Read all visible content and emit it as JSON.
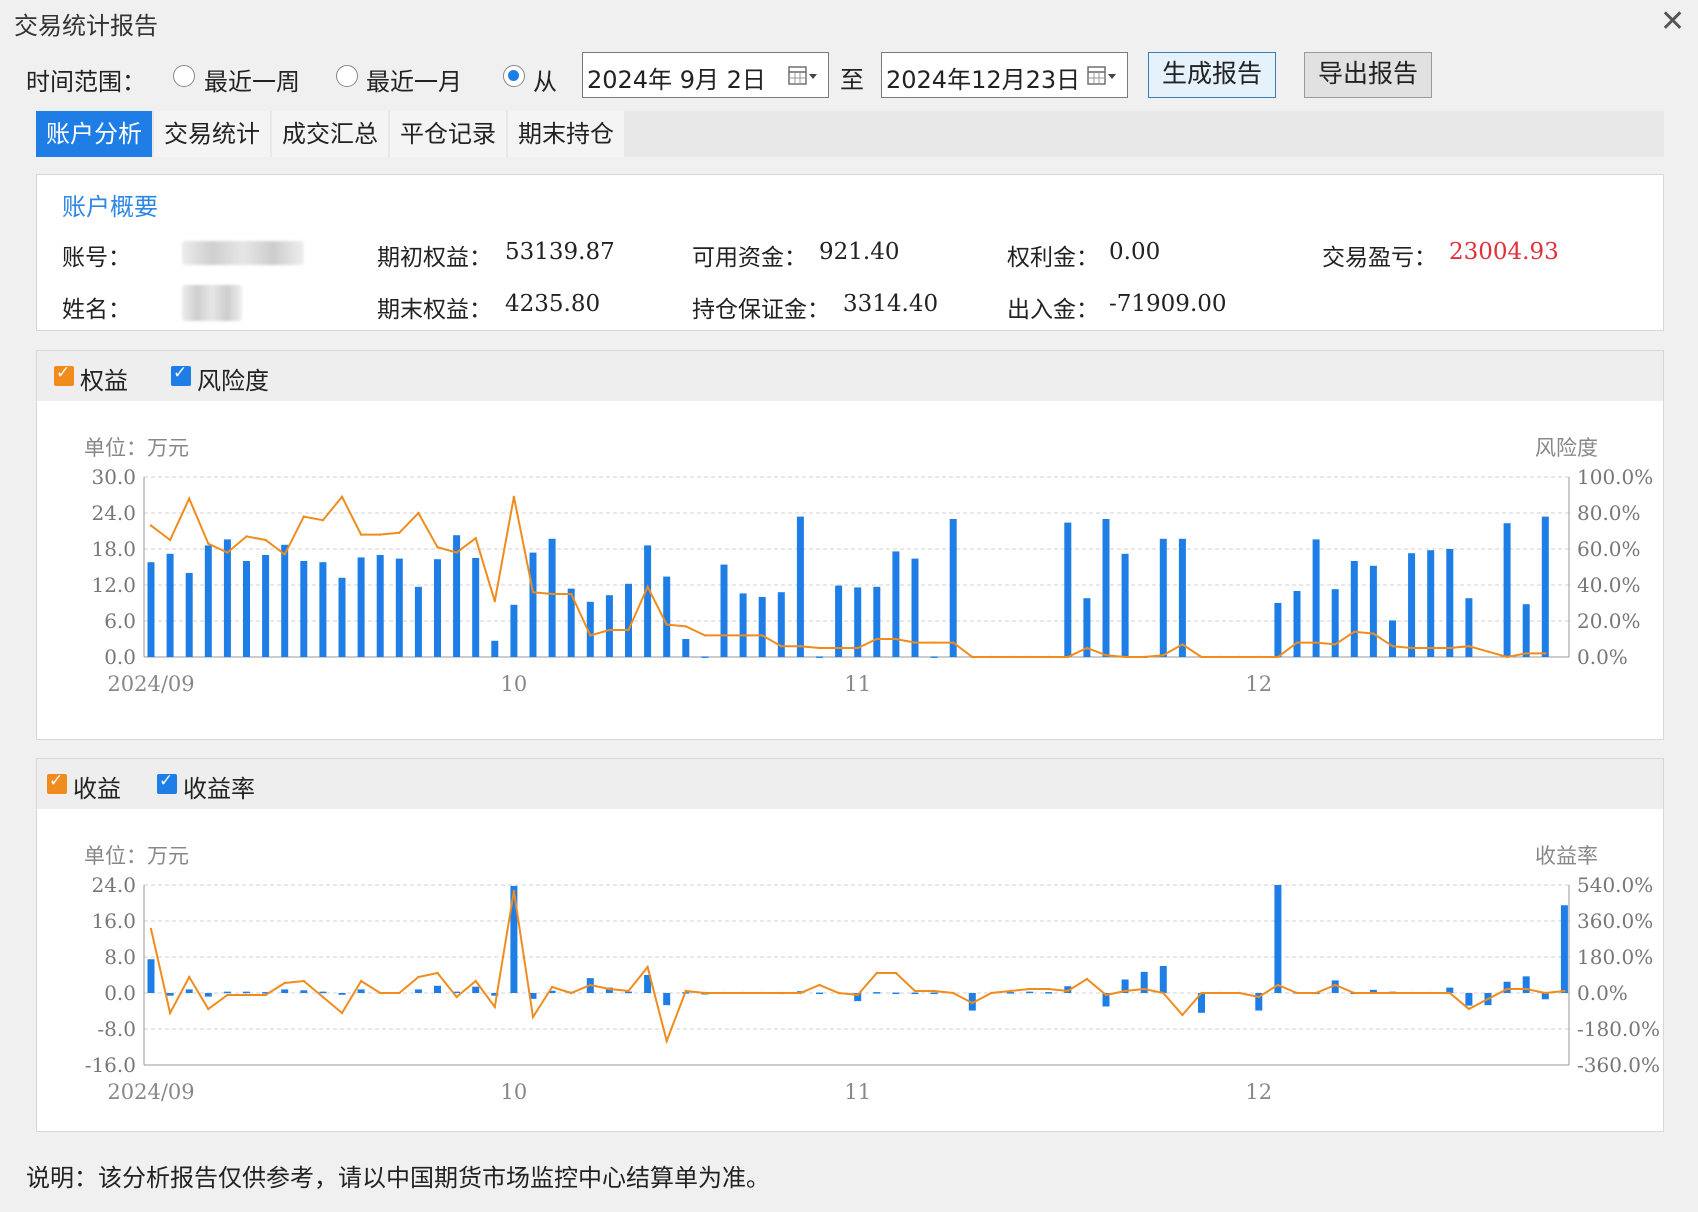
{
  "window": {
    "title": "交易统计报告",
    "close_glyph": "✕"
  },
  "time_range": {
    "label": "时间范围：",
    "options": [
      "最近一周",
      "最近一月",
      "从"
    ],
    "selected_index": 2,
    "from_date": "2024年 9月 2日",
    "to_label": "至",
    "to_date": "2024年12月23日",
    "date_picker_icon": "calendar-dropdown-icon"
  },
  "buttons": {
    "generate": "生成报告",
    "export": "导出报告"
  },
  "tabs": {
    "items": [
      "账户分析",
      "交易统计",
      "成交汇总",
      "平仓记录",
      "期末持仓"
    ],
    "active": 0
  },
  "summary": {
    "title": "账户概要",
    "account_label": "账号：",
    "name_label": "姓名：",
    "initial_equity_label": "期初权益：",
    "initial_equity": "53139.87",
    "final_equity_label": "期末权益：",
    "final_equity": "4235.80",
    "available_label": "可用资金：",
    "available": "921.40",
    "margin_label": "持仓保证金：",
    "margin": "3314.40",
    "premium_label": "权利金：",
    "premium": "0.00",
    "inout_label": "出入金：",
    "inout": "-71909.00",
    "pnl_label": "交易盈亏：",
    "pnl": "23004.93"
  },
  "colors": {
    "accent": "#1e7ee6",
    "line": "#f08c1e",
    "loss": "#e0303a",
    "bar": "#1e7ee6"
  },
  "note": "说明：该分析报告仅供参考，请以中国期货市场监控中心结算单为准。",
  "chart_data": [
    {
      "type": "bar",
      "id": "equity-risk",
      "legend": [
        "权益",
        "风险度"
      ],
      "unit_label": "单位：万元",
      "right_axis_label": "风险度",
      "left_ticks": [
        "30.0",
        "24.0",
        "18.0",
        "12.0",
        "6.0",
        "0.0"
      ],
      "right_ticks": [
        "100.0%",
        "80.0%",
        "60.0%",
        "40.0%",
        "20.0%",
        "0.0%"
      ],
      "x_tick_labels": [
        {
          "label": "2024/09",
          "index": 0
        },
        {
          "label": "10",
          "index": 19
        },
        {
          "label": "11",
          "index": 37
        },
        {
          "label": "12",
          "index": 58
        }
      ],
      "ylim": [
        0,
        30
      ],
      "y2lim": [
        0,
        100
      ],
      "series": [
        {
          "name": "权益",
          "kind": "bar",
          "axis": "left",
          "values": [
            15.8,
            17.2,
            14.0,
            18.6,
            19.6,
            16.0,
            17.0,
            18.7,
            16.0,
            15.8,
            13.2,
            16.6,
            17.0,
            16.4,
            11.7,
            16.3,
            20.3,
            16.5,
            2.7,
            8.7,
            17.4,
            19.7,
            11.4,
            9.2,
            10.3,
            12.2,
            18.6,
            13.4,
            3.0,
            0.1,
            15.4,
            10.6,
            10.0,
            10.8,
            23.4,
            0.1,
            11.9,
            11.6,
            11.7,
            17.6,
            16.4,
            0.1,
            23.0,
            0,
            0,
            0,
            0,
            0,
            22.4,
            9.8,
            23.0,
            17.2,
            0.1,
            19.7,
            19.7,
            0,
            0,
            0,
            0,
            9.0,
            11.0,
            19.6,
            11.3,
            16.0,
            15.2,
            6.1,
            17.3,
            17.8,
            18.0,
            9.8,
            0,
            22.3,
            8.8,
            23.4
          ]
        },
        {
          "name": "风险度",
          "kind": "line",
          "axis": "right",
          "values": [
            73,
            65,
            88,
            63,
            58,
            67,
            65,
            57,
            78,
            76,
            89,
            68,
            68,
            69,
            80,
            61,
            58,
            66,
            31,
            89,
            36,
            35,
            35,
            12,
            15,
            15,
            39,
            18,
            17,
            12,
            12,
            12,
            12,
            6,
            6,
            5,
            5,
            5,
            10,
            10,
            8,
            8,
            8,
            0,
            0,
            0,
            0,
            0,
            0,
            5,
            1,
            0,
            0,
            1,
            7,
            0,
            0,
            0,
            0,
            0,
            8,
            8,
            7,
            14,
            13,
            6,
            5,
            5,
            5,
            6,
            3,
            0,
            2,
            2
          ]
        }
      ]
    },
    {
      "type": "bar",
      "id": "profit-rate",
      "legend": [
        "收益",
        "收益率"
      ],
      "unit_label": "单位：万元",
      "right_axis_label": "收益率",
      "left_ticks": [
        "24.0",
        "16.0",
        "8.0",
        "0.0",
        "-8.0",
        "-16.0"
      ],
      "right_ticks": [
        "540.0%",
        "360.0%",
        "180.0%",
        "0.0%",
        "-180.0%",
        "-360.0%"
      ],
      "x_tick_labels": [
        {
          "label": "2024/09",
          "index": 0
        },
        {
          "label": "10",
          "index": 19
        },
        {
          "label": "11",
          "index": 37
        },
        {
          "label": "12",
          "index": 58
        }
      ],
      "ylim": [
        -16,
        24
      ],
      "y2lim": [
        -360,
        540
      ],
      "series": [
        {
          "name": "收益",
          "kind": "bar",
          "axis": "left",
          "values": [
            7.5,
            -0.6,
            0.8,
            -0.8,
            0.3,
            0.3,
            0.2,
            0.8,
            0.6,
            0.3,
            -0.4,
            0.8,
            0,
            0,
            0.8,
            1.6,
            0.3,
            1.4,
            -0.6,
            23.8,
            -1.3,
            0.5,
            0.3,
            3.3,
            1.2,
            0.3,
            4.0,
            -2.7,
            0.2,
            -0.3,
            0.2,
            0,
            0,
            0.1,
            0.4,
            0.1,
            0,
            -1.8,
            0.2,
            0.1,
            0.1,
            0.1,
            0,
            -3.9,
            0,
            0.2,
            0.3,
            0.2,
            1.5,
            0,
            -3.0,
            3.0,
            4.7,
            6.0,
            0,
            -4.4,
            0,
            0,
            -3.9,
            24.0,
            0.2,
            0.1,
            2.8,
            0.1,
            0.7,
            0.3,
            0.2,
            0.2,
            1.2,
            -2.8,
            -2.7,
            2.5,
            3.7,
            -1.4,
            19.5
          ]
        },
        {
          "name": "收益率",
          "kind": "line",
          "axis": "right",
          "values": [
            320,
            -100,
            80,
            -80,
            -10,
            -10,
            -10,
            50,
            60,
            -20,
            -100,
            60,
            0,
            0,
            80,
            100,
            -20,
            60,
            -70,
            510,
            -120,
            30,
            0,
            40,
            20,
            10,
            130,
            -240,
            10,
            0,
            0,
            0,
            0,
            0,
            0,
            40,
            0,
            -10,
            100,
            100,
            10,
            10,
            0,
            -50,
            0,
            10,
            20,
            20,
            10,
            70,
            -10,
            10,
            20,
            0,
            -110,
            0,
            0,
            0,
            -20,
            40,
            0,
            0,
            40,
            0,
            0,
            0,
            0,
            0,
            0,
            -80,
            -30,
            20,
            20,
            0,
            10
          ]
        }
      ]
    }
  ]
}
